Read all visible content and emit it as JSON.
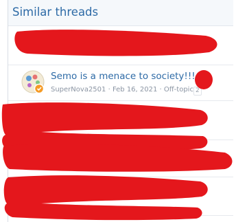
{
  "block": {
    "title": "Similar threads"
  },
  "thread": {
    "title": "Semo is a menace to society!!!",
    "author": "SuperNova2501",
    "date": "Feb 16, 2021",
    "forum": "Off-topic",
    "replies": "2",
    "separator": " · "
  },
  "colors": {
    "link": "#2d6aa6",
    "meta": "#8b95a3",
    "redaction": "#e4171c",
    "header_bg": "#f5f8fb"
  },
  "icons": {
    "avatar": "avatar-icon",
    "badge": "orange-badge-icon"
  }
}
